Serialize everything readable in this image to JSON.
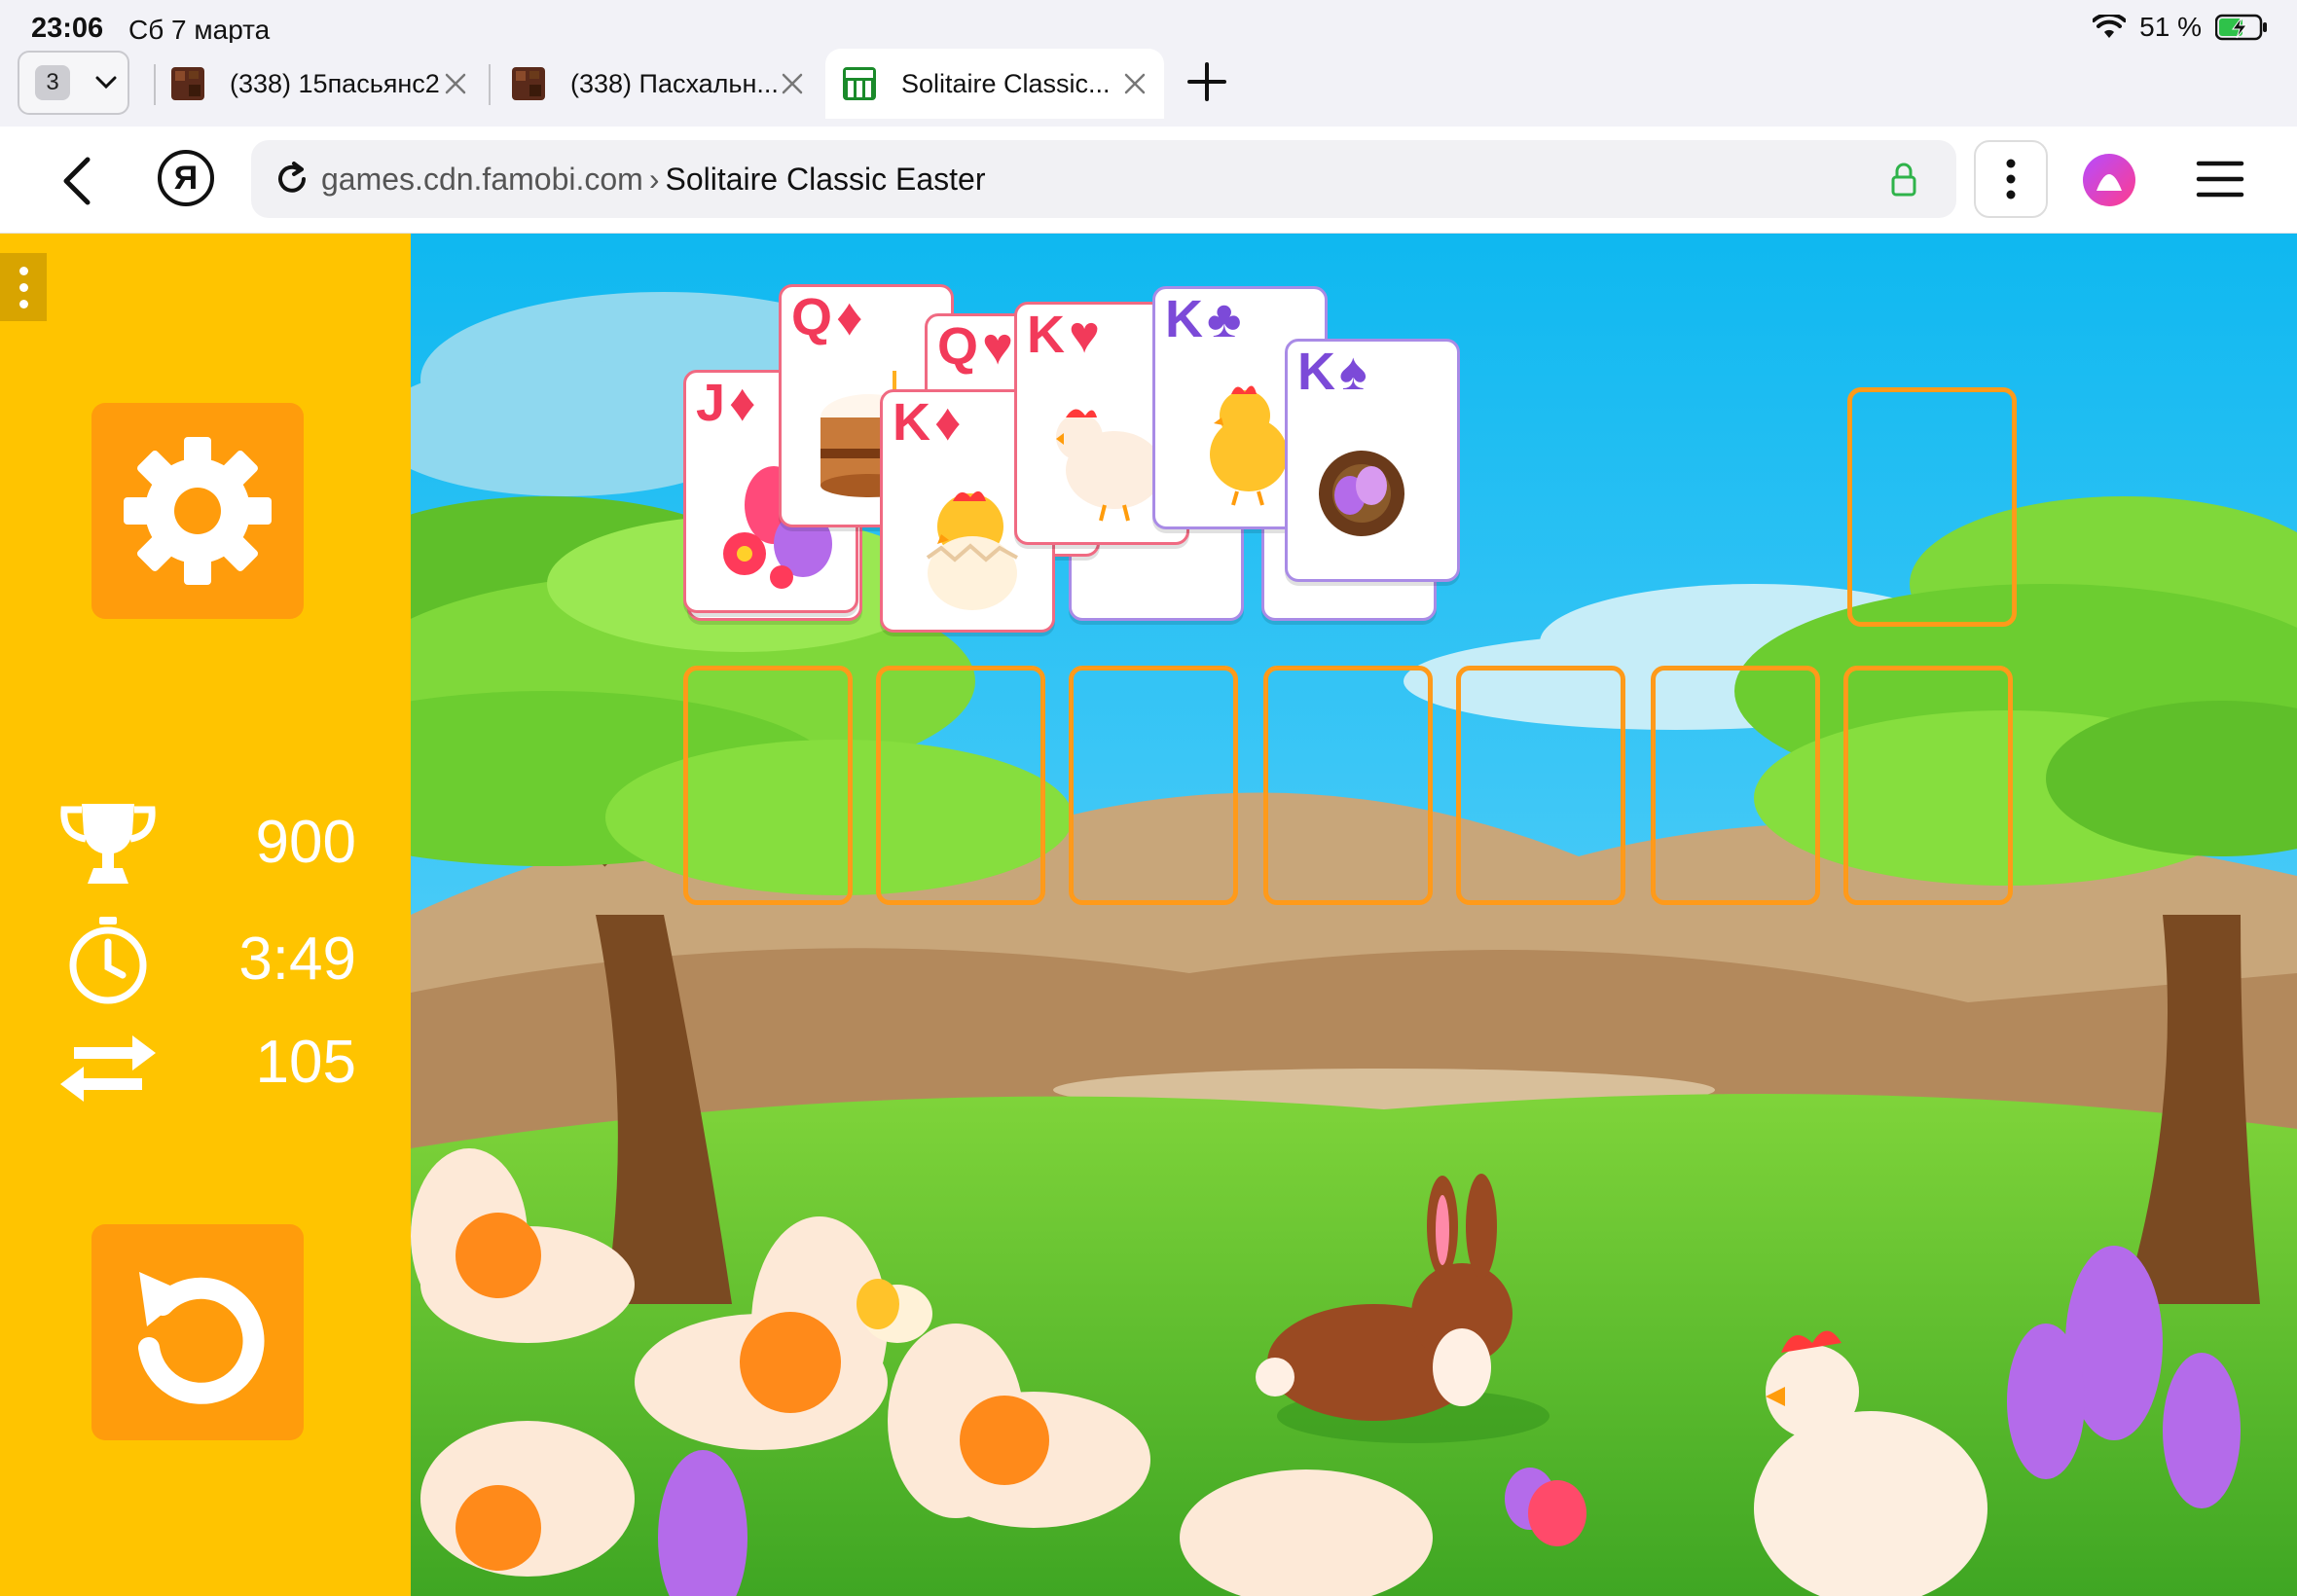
{
  "status": {
    "time": "23:06",
    "date": "Сб 7 марта",
    "battery": "51 %"
  },
  "tabs": {
    "count": "3",
    "items": [
      {
        "title": "(338) 15пасьянс2",
        "active": false
      },
      {
        "title": "(338) Пасхальн...",
        "active": false
      },
      {
        "title": "Solitaire Classic...",
        "active": true
      }
    ]
  },
  "address": {
    "domain": "games.cdn.famobi.com",
    "separator": "›",
    "page_title": "Solitaire Classic Easter",
    "ya_logo": "Я"
  },
  "game": {
    "score": "900",
    "time": "3:49",
    "moves": "105",
    "icons": {
      "settings": "gear-icon",
      "score": "trophy-icon",
      "time": "stopwatch-icon",
      "moves": "swap-arrows-icon",
      "undo": "undo-icon"
    },
    "colors": {
      "panel": "#ffc400",
      "button": "#ff9c0c",
      "slot": "#ff9a1a",
      "red_suit": "#f23a5a",
      "black_suit": "#7c4ad8"
    },
    "cards": [
      {
        "rank": "J",
        "suit": "♦",
        "color": "red",
        "art": "egg"
      },
      {
        "rank": "Q",
        "suit": "♦",
        "color": "red",
        "art": "cake"
      },
      {
        "rank": "Q",
        "suit": "♥",
        "color": "red",
        "art": "none"
      },
      {
        "rank": "K",
        "suit": "♦",
        "color": "red",
        "art": "chick-egg"
      },
      {
        "rank": "K",
        "suit": "♥",
        "color": "red",
        "art": "hen"
      },
      {
        "rank": "K",
        "suit": "♣",
        "color": "black",
        "art": "chick"
      },
      {
        "rank": "K",
        "suit": "♠",
        "color": "black",
        "art": "nest"
      }
    ]
  }
}
